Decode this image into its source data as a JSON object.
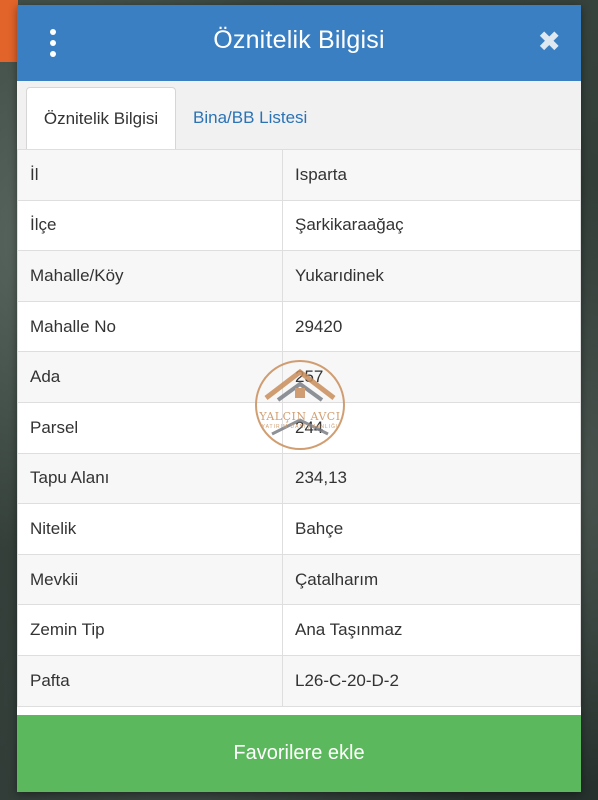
{
  "header": {
    "title": "Öznitelik Bilgisi",
    "menu_icon": "more-vertical-icon",
    "close_icon": "close-icon",
    "close_glyph": "✖"
  },
  "tabs": [
    {
      "label": "Öznitelik Bilgisi",
      "active": true
    },
    {
      "label": "Bina/BB Listesi",
      "active": false
    }
  ],
  "attributes": [
    {
      "key": "İl",
      "value": "Isparta"
    },
    {
      "key": "İlçe",
      "value": "Şarkikaraağaç"
    },
    {
      "key": "Mahalle/Köy",
      "value": "Yukarıdinek"
    },
    {
      "key": "Mahalle No",
      "value": "29420"
    },
    {
      "key": "Ada",
      "value": "257"
    },
    {
      "key": "Parsel",
      "value": "244"
    },
    {
      "key": "Tapu Alanı",
      "value": "234,13"
    },
    {
      "key": "Nitelik",
      "value": "Bahçe"
    },
    {
      "key": "Mevkii",
      "value": "Çatalharım"
    },
    {
      "key": "Zemin Tip",
      "value": "Ana Taşınmaz"
    },
    {
      "key": "Pafta",
      "value": "L26-C-20-D-2"
    }
  ],
  "watermark": {
    "name": "YALÇIN AVCI",
    "sub": "YATIRIM DANIŞMANLIĞI"
  },
  "footer": {
    "button_label": "Favorilere ekle"
  },
  "colors": {
    "header": "#3a7fc2",
    "button": "#5cb85c",
    "tab_link": "#2b73b5"
  }
}
